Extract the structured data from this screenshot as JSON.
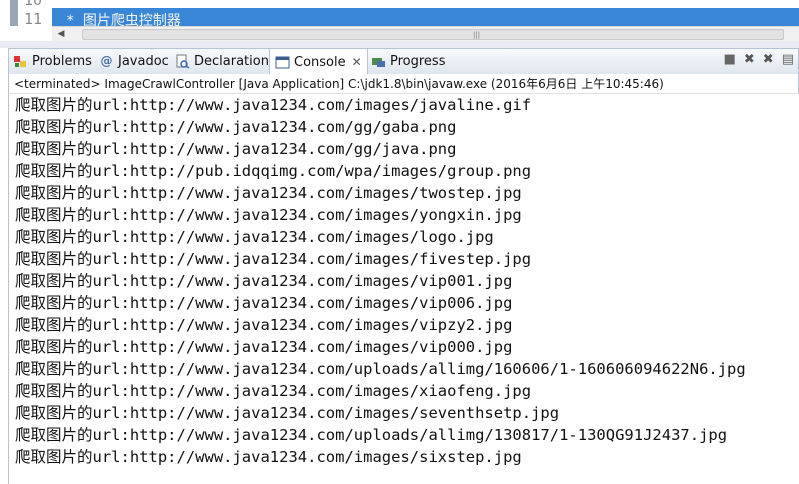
{
  "editor": {
    "line_numbers": [
      "10",
      "11"
    ],
    "current_line_text": "  *  图片爬虫控制器"
  },
  "tabs": [
    {
      "label": "Problems",
      "icon": "problems-icon"
    },
    {
      "label": "Javadoc",
      "icon": "javadoc-icon"
    },
    {
      "label": "Declaration",
      "icon": "declaration-icon"
    },
    {
      "label": "Console",
      "icon": "console-icon",
      "active": true
    },
    {
      "label": "Progress",
      "icon": "progress-icon"
    }
  ],
  "status_line": "<terminated> ImageCrawlController [Java Application] C:\\jdk1.8\\bin\\javaw.exe (2016年6月6日 上午10:45:46)",
  "console_lines": [
    "爬取图片的url:http://www.java1234.com/images/javaline.gif",
    "爬取图片的url:http://www.java1234.com/gg/gaba.png",
    "爬取图片的url:http://www.java1234.com/gg/java.png",
    "爬取图片的url:http://pub.idqqimg.com/wpa/images/group.png",
    "爬取图片的url:http://www.java1234.com/images/twostep.jpg",
    "爬取图片的url:http://www.java1234.com/images/yongxin.jpg",
    "爬取图片的url:http://www.java1234.com/images/logo.jpg",
    "爬取图片的url:http://www.java1234.com/images/fivestep.jpg",
    "爬取图片的url:http://www.java1234.com/images/vip001.jpg",
    "爬取图片的url:http://www.java1234.com/images/vip006.jpg",
    "爬取图片的url:http://www.java1234.com/images/vipzy2.jpg",
    "爬取图片的url:http://www.java1234.com/images/vip000.jpg",
    "爬取图片的url:http://www.java1234.com/uploads/allimg/160606/1-160606094622N6.jpg",
    "爬取图片的url:http://www.java1234.com/images/xiaofeng.jpg",
    "爬取图片的url:http://www.java1234.com/images/seventhsetp.jpg",
    "爬取图片的url:http://www.java1234.com/uploads/allimg/130817/1-130QG91J2437.jpg",
    "爬取图片的url:http://www.java1234.com/images/sixstep.jpg"
  ],
  "colors": {
    "current_line": "#3a86d6",
    "tab_border": "#b8c3d1"
  }
}
